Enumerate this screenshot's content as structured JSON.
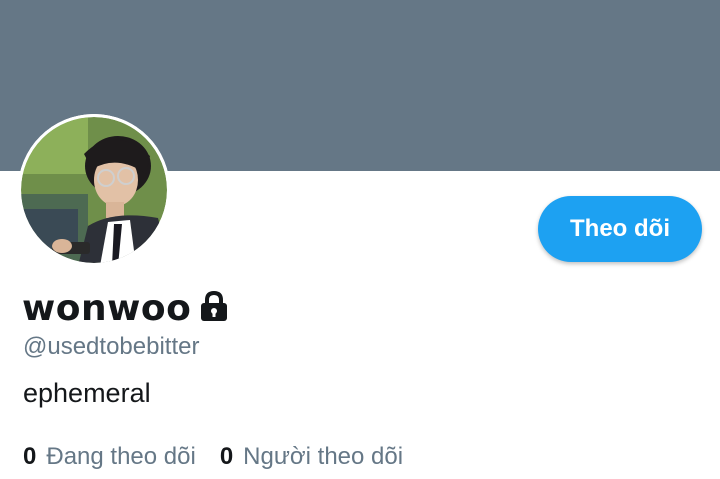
{
  "profile": {
    "display_name": "wonwoo",
    "handle": "@usedtobebitter",
    "bio": "ephemeral",
    "follow_button_label": "Theo dõi",
    "locked_icon": "lock-icon"
  },
  "stats": {
    "following_count": "0",
    "following_label": "Đang theo dõi",
    "followers_count": "0",
    "followers_label": "Người theo dõi"
  },
  "colors": {
    "banner": "#657786",
    "accent": "#1da1f2",
    "text_primary": "#14171a",
    "text_secondary": "#657786"
  }
}
